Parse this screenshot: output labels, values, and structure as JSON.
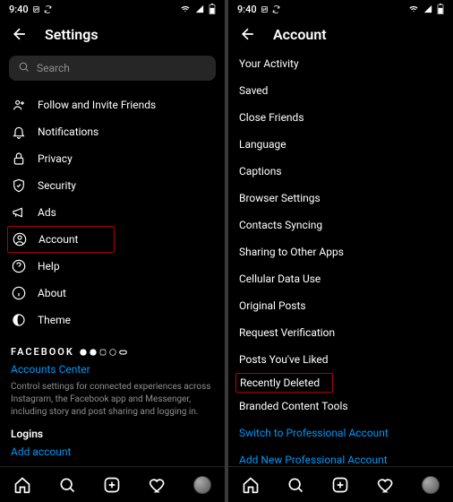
{
  "status": {
    "time": "9:40",
    "network_icons": "nfc,sync",
    "right_icons": "wifi,signal,battery"
  },
  "left": {
    "title": "Settings",
    "search_placeholder": "Search",
    "menu": [
      {
        "icon": "follow-invite-icon",
        "label": "Follow and Invite Friends"
      },
      {
        "icon": "bell-icon",
        "label": "Notifications"
      },
      {
        "icon": "lock-icon",
        "label": "Privacy"
      },
      {
        "icon": "shield-icon",
        "label": "Security"
      },
      {
        "icon": "megaphone-icon",
        "label": "Ads"
      },
      {
        "icon": "account-icon",
        "label": "Account",
        "highlight": true
      },
      {
        "icon": "help-icon",
        "label": "Help"
      },
      {
        "icon": "info-icon",
        "label": "About"
      },
      {
        "icon": "theme-icon",
        "label": "Theme"
      }
    ],
    "facebook_label": "FACEBOOK",
    "accounts_center": "Accounts Center",
    "accounts_center_desc": "Control settings for connected experiences across Instagram, the Facebook app and Messenger, including story and post sharing and logging in.",
    "logins_label": "Logins",
    "add_account": "Add account"
  },
  "right": {
    "title": "Account",
    "items": [
      "Your Activity",
      "Saved",
      "Close Friends",
      "Language",
      "Captions",
      "Browser Settings",
      "Contacts Syncing",
      "Sharing to Other Apps",
      "Cellular Data Use",
      "Original Posts",
      "Request Verification",
      "Posts You've Liked",
      "Recently Deleted",
      "Branded Content Tools"
    ],
    "highlight_index": 12,
    "switch_professional": "Switch to Professional Account",
    "add_professional": "Add New Professional Account"
  }
}
